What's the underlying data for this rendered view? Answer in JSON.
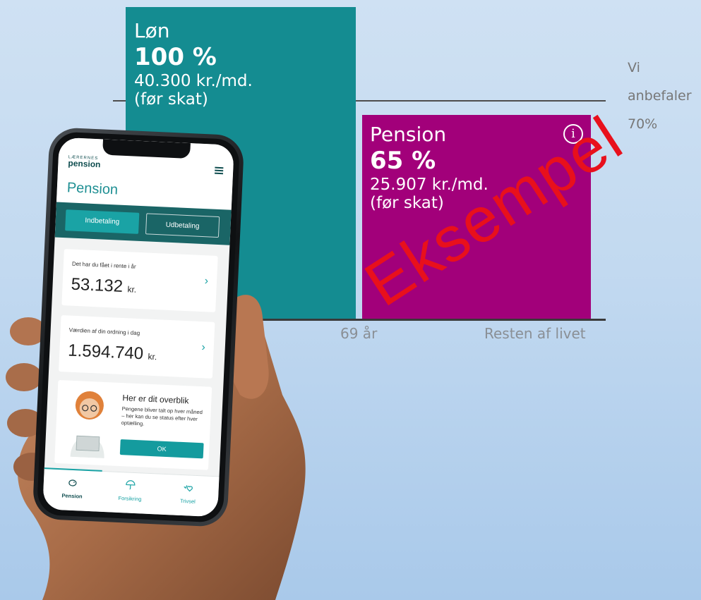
{
  "chart": {
    "salary": {
      "title": "Løn",
      "percent": "100 %",
      "amount": "40.300 kr./md.",
      "note": "(før skat)"
    },
    "pension": {
      "title": "Pension",
      "percent": "65 %",
      "amount": "25.907 kr./md.",
      "note": "(før skat)"
    },
    "axis_left": "69 år",
    "axis_right": "Resten af livet",
    "recommendation": [
      "Vi",
      "anbefaler",
      "70%"
    ],
    "watermark": "Eksempel",
    "colors": {
      "salary": "#148c91",
      "pension": "#a2007a",
      "watermark": "#e8101c"
    }
  },
  "app": {
    "logo_small": "LÆRERNES",
    "logo_big": "pension",
    "page_title": "Pension",
    "tabs": [
      {
        "label": "Indbetaling",
        "active": true
      },
      {
        "label": "Udbetaling",
        "active": false
      }
    ],
    "cards": [
      {
        "label": "Det har du fået i rente i år",
        "value": "53.132",
        "unit": "kr."
      },
      {
        "label": "Værdien af din ordning i dag",
        "value": "1.594.740",
        "unit": "kr."
      }
    ],
    "overview": {
      "title": "Her er dit overblik",
      "text": "Pengene bliver talt op hver måned – her kan du se status efter hver optælling.",
      "button": "OK"
    },
    "nav": [
      {
        "label": "Pension",
        "icon": "piggy-bank-icon"
      },
      {
        "label": "Forsikring",
        "icon": "umbrella-icon"
      },
      {
        "label": "Trivsel",
        "icon": "heart-check-icon"
      }
    ],
    "accent": "#1aa3a5"
  }
}
